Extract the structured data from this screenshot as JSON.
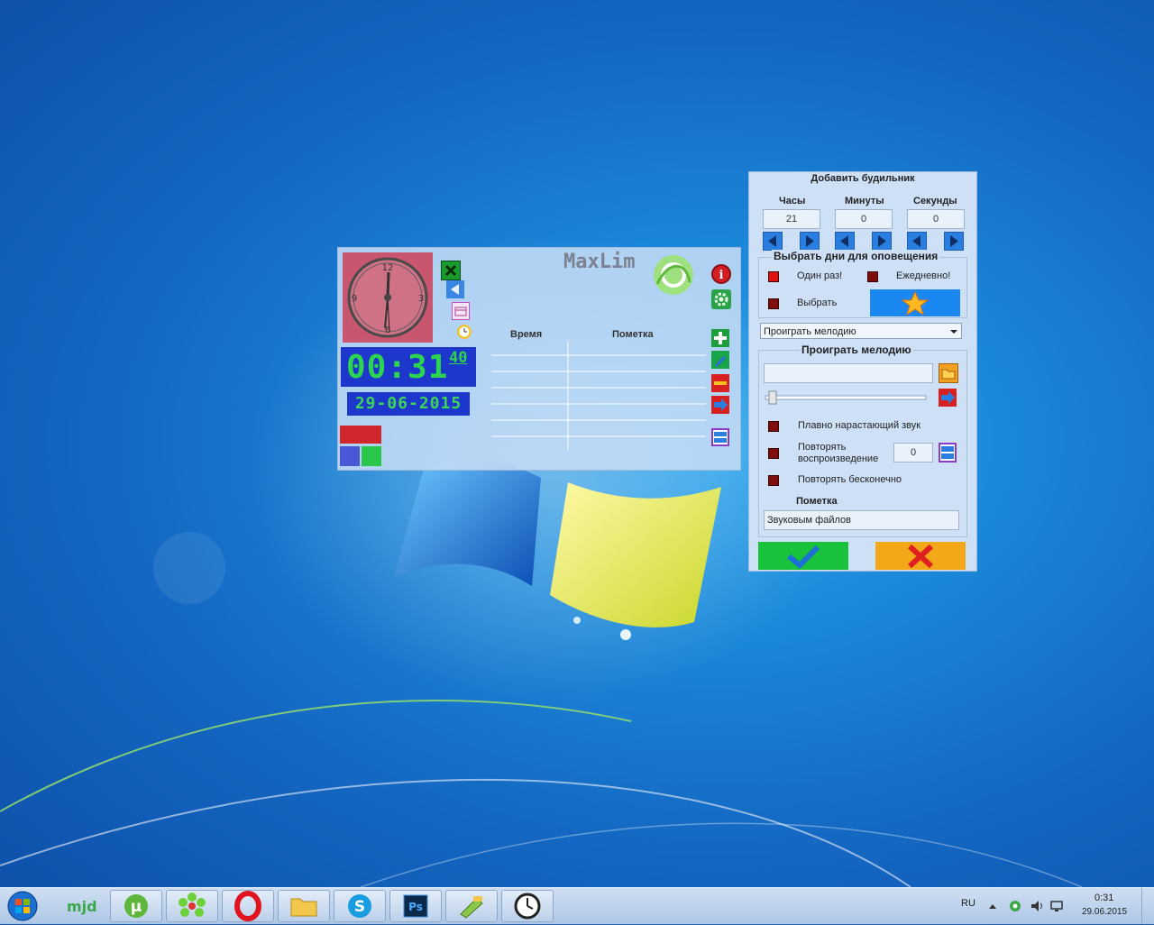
{
  "clock_window": {
    "logo": "MaxLim",
    "analog_numerals": {
      "n12": "12",
      "n3": "3",
      "n6": "6",
      "n9": "9"
    },
    "time_hm": "00:31",
    "time_sec": "40",
    "date": "29-06-2015",
    "table_headers": [
      "Время",
      "Пометка"
    ]
  },
  "alarm": {
    "title": "Добавить будильник",
    "hours_label": "Часы",
    "minutes_label": "Минуты",
    "seconds_label": "Секунды",
    "hours": "21",
    "minutes": "0",
    "seconds": "0",
    "days_group_title": "Выбрать дни для оповещения",
    "once_label": "Один раз!",
    "daily_label": "Ежедневно!",
    "choose_label": "Выбрать",
    "action_select": "Проиграть мелодию",
    "melody_group_title": "Проиграть мелодию",
    "fade_in_label": "Плавно нарастающий звук",
    "repeat_label_1": "Повторять",
    "repeat_label_2": "воспроизведение",
    "repeat_count": "0",
    "repeat_forever_label": "Повторять бесконечно",
    "note_label": "Пометка",
    "note_value": "Звуковым файлов"
  },
  "tray": {
    "lang": "RU",
    "time": "0:31",
    "date": "29.06.2015"
  },
  "taskbar_apps": [
    "mjd",
    "uTorrent",
    "ICQ",
    "Opera",
    "Explorer",
    "Skype",
    "Photoshop",
    "Tool",
    "Clock"
  ],
  "colors": {
    "accent_green": "#2dd44f",
    "digital_bg": "#1d36cc",
    "ok_green": "#18c23a",
    "cancel_orange": "#f3a81a"
  }
}
